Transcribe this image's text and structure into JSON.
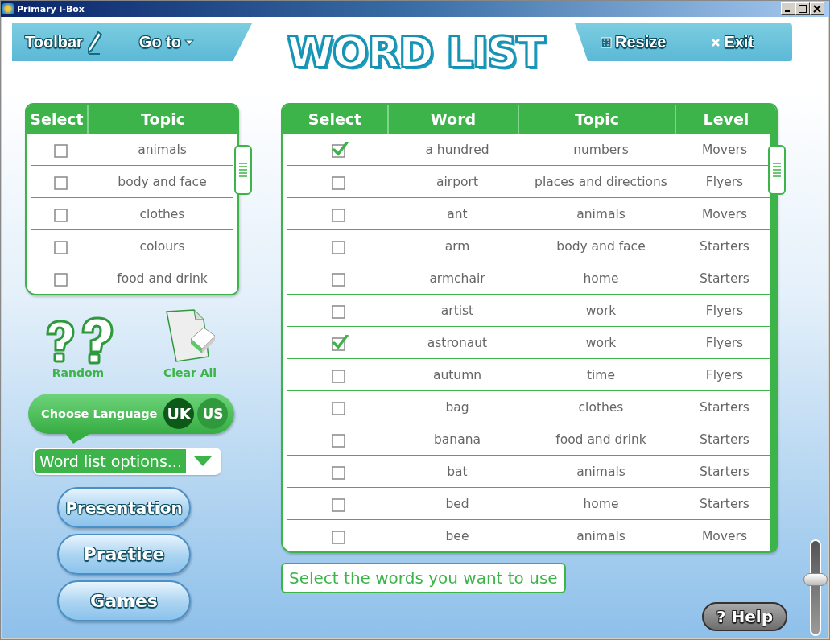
{
  "window": {
    "title": "Primary i-Box"
  },
  "toolbar_left": [
    {
      "label": "Toolbar"
    },
    {
      "label": "Go to"
    }
  ],
  "title": "WORD LIST",
  "toolbar_right": [
    {
      "label": "Resize"
    },
    {
      "label": "Exit"
    }
  ],
  "topics_table": {
    "columns": [
      "Select",
      "Topic"
    ],
    "rows": [
      {
        "topic": "animals",
        "checked": false
      },
      {
        "topic": "body and face",
        "checked": false
      },
      {
        "topic": "clothes",
        "checked": false
      },
      {
        "topic": "colours",
        "checked": false
      },
      {
        "topic": "food and drink",
        "checked": false
      }
    ]
  },
  "actions": [
    {
      "label": "Random",
      "kind": "random"
    },
    {
      "label": "Clear All",
      "kind": "clear"
    }
  ],
  "language": {
    "label": "Choose Language",
    "options": [
      {
        "label": "UK",
        "selected": true
      },
      {
        "label": "US",
        "selected": false
      }
    ]
  },
  "options_dropdown": {
    "value": "Word list options..."
  },
  "nav_buttons": [
    "Presentation",
    "Practice",
    "Games"
  ],
  "words_table": {
    "columns": [
      "Select",
      "Word",
      "Topic",
      "Level"
    ],
    "rows": [
      {
        "word": "a hundred",
        "topic": "numbers",
        "level": "Movers",
        "checked": true
      },
      {
        "word": "airport",
        "topic": "places and directions",
        "level": "Flyers",
        "checked": false
      },
      {
        "word": "ant",
        "topic": "animals",
        "level": "Movers",
        "checked": false
      },
      {
        "word": "arm",
        "topic": "body and face",
        "level": "Starters",
        "checked": false
      },
      {
        "word": "armchair",
        "topic": "home",
        "level": "Starters",
        "checked": false
      },
      {
        "word": "artist",
        "topic": "work",
        "level": "Flyers",
        "checked": false
      },
      {
        "word": "astronaut",
        "topic": "work",
        "level": "Flyers",
        "checked": true
      },
      {
        "word": "autumn",
        "topic": "time",
        "level": "Flyers",
        "checked": false
      },
      {
        "word": "bag",
        "topic": "clothes",
        "level": "Starters",
        "checked": false
      },
      {
        "word": "banana",
        "topic": "food and drink",
        "level": "Starters",
        "checked": false
      },
      {
        "word": "bat",
        "topic": "animals",
        "level": "Starters",
        "checked": false
      },
      {
        "word": "bed",
        "topic": "home",
        "level": "Starters",
        "checked": false
      },
      {
        "word": "bee",
        "topic": "animals",
        "level": "Movers",
        "checked": false
      }
    ]
  },
  "instruction": "Select the words you want to use",
  "help_button": "? Help",
  "volume_slider": {
    "level": 0.6
  }
}
